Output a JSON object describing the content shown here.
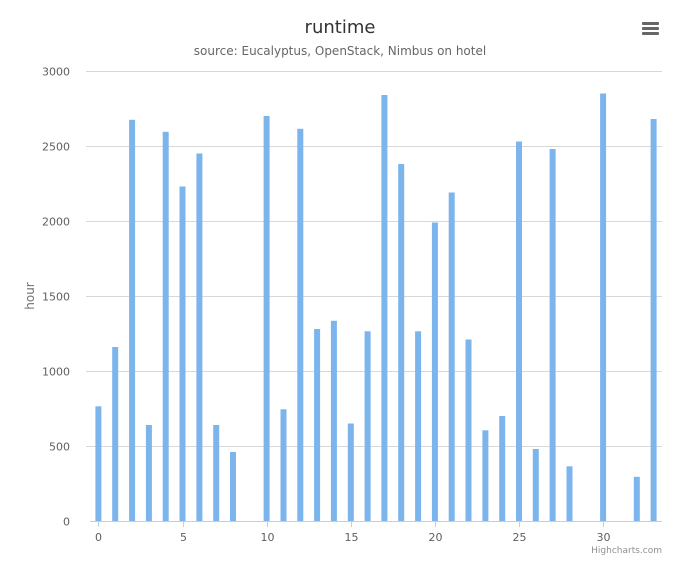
{
  "chart_data": {
    "type": "bar",
    "title": "runtime",
    "subtitle": "source: Eucalyptus, OpenStack, Nimbus on hotel",
    "ylabel": "hour",
    "xlabel": "",
    "ylim": [
      0,
      3000
    ],
    "xlim": [
      -0.5,
      33.5
    ],
    "y_ticks": [
      0,
      500,
      1000,
      1500,
      2000,
      2500,
      3000
    ],
    "x_ticks": [
      0,
      5,
      10,
      15,
      20,
      25,
      30
    ],
    "grid": true,
    "legend": "none",
    "colors": {
      "bar": "#7cb5ec",
      "grid": "#d8d8d8"
    },
    "x": [
      0,
      1,
      2,
      3,
      4,
      5,
      6,
      7,
      8,
      9,
      10,
      11,
      12,
      13,
      14,
      15,
      16,
      17,
      18,
      19,
      20,
      21,
      22,
      23,
      24,
      25,
      26,
      27,
      28,
      29,
      30,
      31,
      32,
      33
    ],
    "values": [
      765,
      1160,
      2675,
      640,
      2595,
      2230,
      2450,
      640,
      460,
      0,
      2700,
      745,
      2615,
      1280,
      1335,
      650,
      1265,
      2840,
      2380,
      1265,
      1990,
      2190,
      1210,
      605,
      700,
      2530,
      480,
      2480,
      365,
      0,
      2850,
      0,
      295,
      2680
    ]
  },
  "export_menu": {
    "icon": "menu-icon"
  },
  "credits": "Highcharts.com"
}
